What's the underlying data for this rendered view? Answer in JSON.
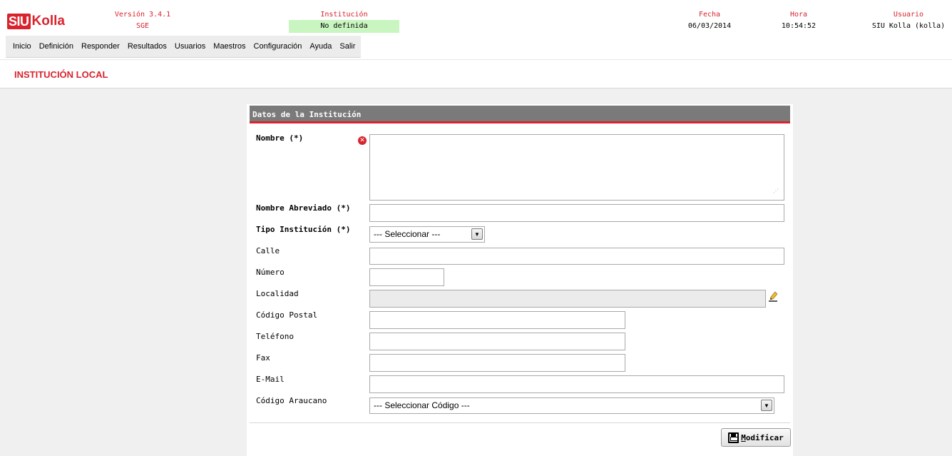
{
  "header": {
    "logo": {
      "part1": "SIU",
      "part2": "Kolla"
    },
    "version": {
      "label": "Versión 3.4.1",
      "value": "SGE"
    },
    "institucion": {
      "label": "Institución",
      "value": "No definida"
    },
    "fecha": {
      "label": "Fecha",
      "value": "06/03/2014"
    },
    "hora": {
      "label": "Hora",
      "value": "10:54:52"
    },
    "usuario": {
      "label": "Usuario",
      "value": "SIU Kolla (kolla)"
    }
  },
  "menu": {
    "items": [
      "Inicio",
      "Definición",
      "Responder",
      "Resultados",
      "Usuarios",
      "Maestros",
      "Configuración",
      "Ayuda",
      "Salir"
    ]
  },
  "page": {
    "title": "INSTITUCIÓN LOCAL"
  },
  "form": {
    "heading": "Datos de la Institución",
    "fields": {
      "nombre": {
        "label": "Nombre (*)",
        "value": ""
      },
      "nombre_abreviado": {
        "label": "Nombre Abreviado (*)",
        "value": ""
      },
      "tipo_institucion": {
        "label": "Tipo Institución (*)",
        "selected": "--- Seleccionar ---"
      },
      "calle": {
        "label": "Calle",
        "value": ""
      },
      "numero": {
        "label": "Número",
        "value": ""
      },
      "localidad": {
        "label": "Localidad",
        "value": ""
      },
      "codigo_postal": {
        "label": "Código Postal",
        "value": ""
      },
      "telefono": {
        "label": "Teléfono",
        "value": ""
      },
      "fax": {
        "label": "Fax",
        "value": ""
      },
      "email": {
        "label": "E-Mail",
        "value": ""
      },
      "codigo_araucano": {
        "label": "Código Araucano",
        "selected": "--- Seleccionar Código ---"
      }
    },
    "submit": {
      "accesskey": "M",
      "rest": "odificar"
    }
  },
  "colors": {
    "brand_red": "#d9232d",
    "institution_bg": "#c8f5c0",
    "panel_head": "#7a7a7a"
  },
  "icons": {
    "error": "error-x-icon",
    "edit": "pencil-edit-icon",
    "save": "floppy-save-icon"
  }
}
